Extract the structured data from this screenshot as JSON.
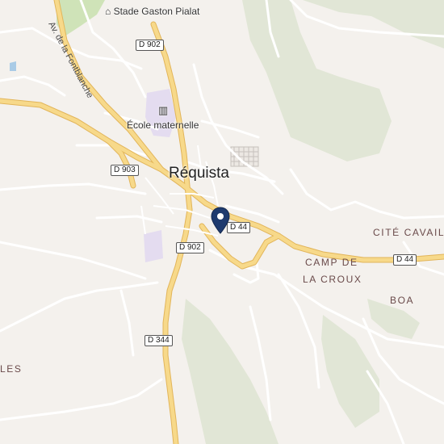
{
  "map": {
    "colors": {
      "background": "#f4f1ed",
      "green": "#e1e6d6",
      "park": "#cfe3b8",
      "school": "#e4dcf0",
      "major_road": "#f5cf6e",
      "minor_road": "#ffffff",
      "marker": "#1e3a6e"
    },
    "labels": {
      "town": "Réquista",
      "stade": "Stade Gaston Pialat",
      "school": "École maternelle",
      "cite": "CITÉ CAVAIL",
      "camp_line1": "CAMP DE",
      "camp_line2": "LA CROUX",
      "boa": "BOA",
      "les": "LES",
      "street": "Av. de la Fontblanche"
    },
    "shields": {
      "d902_north": "D 902",
      "d903": "D 903",
      "d44_center": "D 44",
      "d902_south": "D 902",
      "d44_east": "D 44",
      "d344": "D 344"
    },
    "icons": {
      "stadium": "stadium-icon",
      "school": "school-icon",
      "marker": "location-marker-icon"
    }
  }
}
